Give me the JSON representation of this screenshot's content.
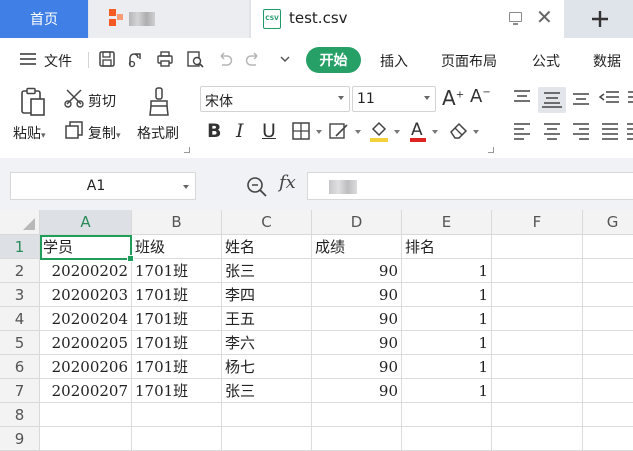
{
  "tabs": {
    "home": "首页",
    "file_title": "test.csv",
    "csv_icon_text": "CSV"
  },
  "menu": {
    "file": "文件",
    "tabs": [
      "开始",
      "插入",
      "页面布局",
      "公式",
      "数据"
    ]
  },
  "ribbon": {
    "cut": "剪切",
    "paste": "粘贴",
    "copy": "复制",
    "format_painter": "格式刷",
    "font_name": "宋体",
    "font_size": "11"
  },
  "formula_bar": {
    "name_box": "A1",
    "fx": "fx"
  },
  "grid": {
    "columns": [
      "A",
      "B",
      "C",
      "D",
      "E",
      "F",
      "G"
    ],
    "row_numbers": [
      "1",
      "2",
      "3",
      "4",
      "5",
      "6",
      "7",
      "8",
      "9"
    ],
    "header": [
      "学员",
      "班级",
      "姓名",
      "成绩",
      "排名"
    ],
    "rows": [
      [
        "20200202",
        "1701班",
        "张三",
        "90",
        "1"
      ],
      [
        "20200203",
        "1701班",
        "李四",
        "90",
        "1"
      ],
      [
        "20200204",
        "1701班",
        "王五",
        "90",
        "1"
      ],
      [
        "20200205",
        "1701班",
        "李六",
        "90",
        "1"
      ],
      [
        "20200206",
        "1701班",
        "杨七",
        "90",
        "1"
      ],
      [
        "20200207",
        "1701班",
        "张三",
        "90",
        "1"
      ]
    ]
  },
  "colors": {
    "accent": "#27a067",
    "home_tab": "#3f7fe6",
    "selection": "#1e9e5a"
  }
}
